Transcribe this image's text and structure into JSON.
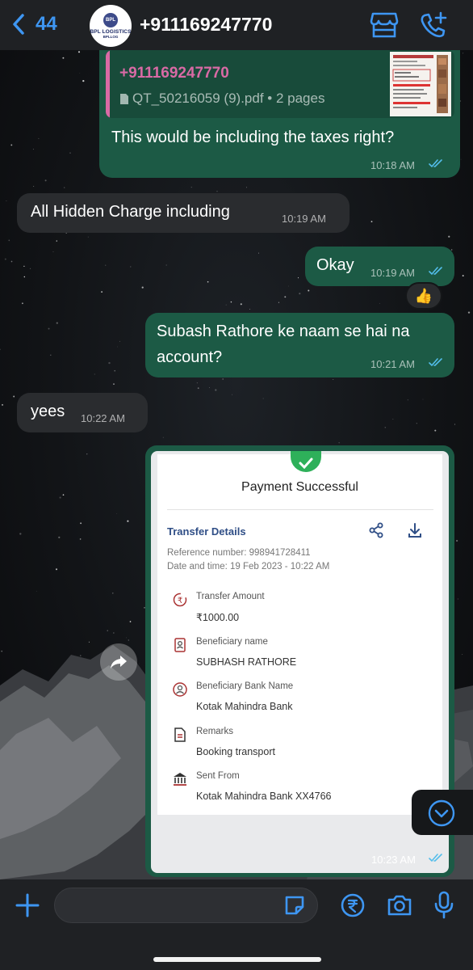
{
  "header": {
    "back_count": "44",
    "avatar": {
      "logo_badge": "BPL",
      "logo_text": "BPL LOGISTICS",
      "logo_sub": "BPLLOG"
    },
    "contact": "+911169247770",
    "icons": [
      "back-chevron-icon",
      "store-icon",
      "add-call-icon"
    ]
  },
  "messages": [
    {
      "id": "m1",
      "direction": "outgoing",
      "quote": {
        "author": "+911169247770",
        "file": "QT_50216059 (9).pdf • 2 pages"
      },
      "text": "This would be including the taxes right?",
      "time": "10:18 AM",
      "status": "read"
    },
    {
      "id": "m2",
      "direction": "incoming",
      "text": "All Hidden Charge including",
      "time": "10:19 AM"
    },
    {
      "id": "m3",
      "direction": "outgoing",
      "text": "Okay",
      "time": "10:19 AM",
      "status": "read",
      "reaction": "👍"
    },
    {
      "id": "m4",
      "direction": "outgoing",
      "text": "Subash Rathore ke naam se hai na account?",
      "text_line1": "Subash Rathore ke naam se hai na",
      "text_line2": "account?",
      "time": "10:21 AM",
      "status": "read"
    },
    {
      "id": "m5",
      "direction": "incoming",
      "text": "yees",
      "time": "10:22 AM"
    },
    {
      "id": "m6",
      "direction": "outgoing",
      "type": "image",
      "time": "10:23 AM",
      "status": "read",
      "receipt": {
        "title": "Payment Successful",
        "section": "Transfer Details",
        "reference": "Reference number: 998941728411",
        "datetime": "Date and time: 19 Feb 2023 - 10:22 AM",
        "rows": [
          {
            "label": "Transfer Amount",
            "value": "₹1000.00",
            "icon": "rupee-transfer-icon"
          },
          {
            "label": "Beneficiary name",
            "value": "SUBHASH RATHORE",
            "icon": "id-card-icon"
          },
          {
            "label": "Beneficiary Bank Name",
            "value": "Kotak Mahindra Bank",
            "icon": "bank-user-icon"
          },
          {
            "label": "Remarks",
            "value": "Booking transport",
            "icon": "document-icon"
          },
          {
            "label": "Sent From",
            "value": "Kotak Mahindra Bank XX4766",
            "icon": "bank-icon"
          }
        ]
      }
    }
  ],
  "composer": {
    "placeholder": "",
    "icons": [
      "plus-icon",
      "sticker-icon",
      "rupee-payment-icon",
      "camera-icon",
      "microphone-icon"
    ]
  },
  "colors": {
    "accent": "#3e96f2",
    "outgoing_bubble": "#1c5a45",
    "incoming_bubble": "#2a2c2f",
    "read_tick": "#53bdeb",
    "quote_author": "#d96aa5"
  }
}
